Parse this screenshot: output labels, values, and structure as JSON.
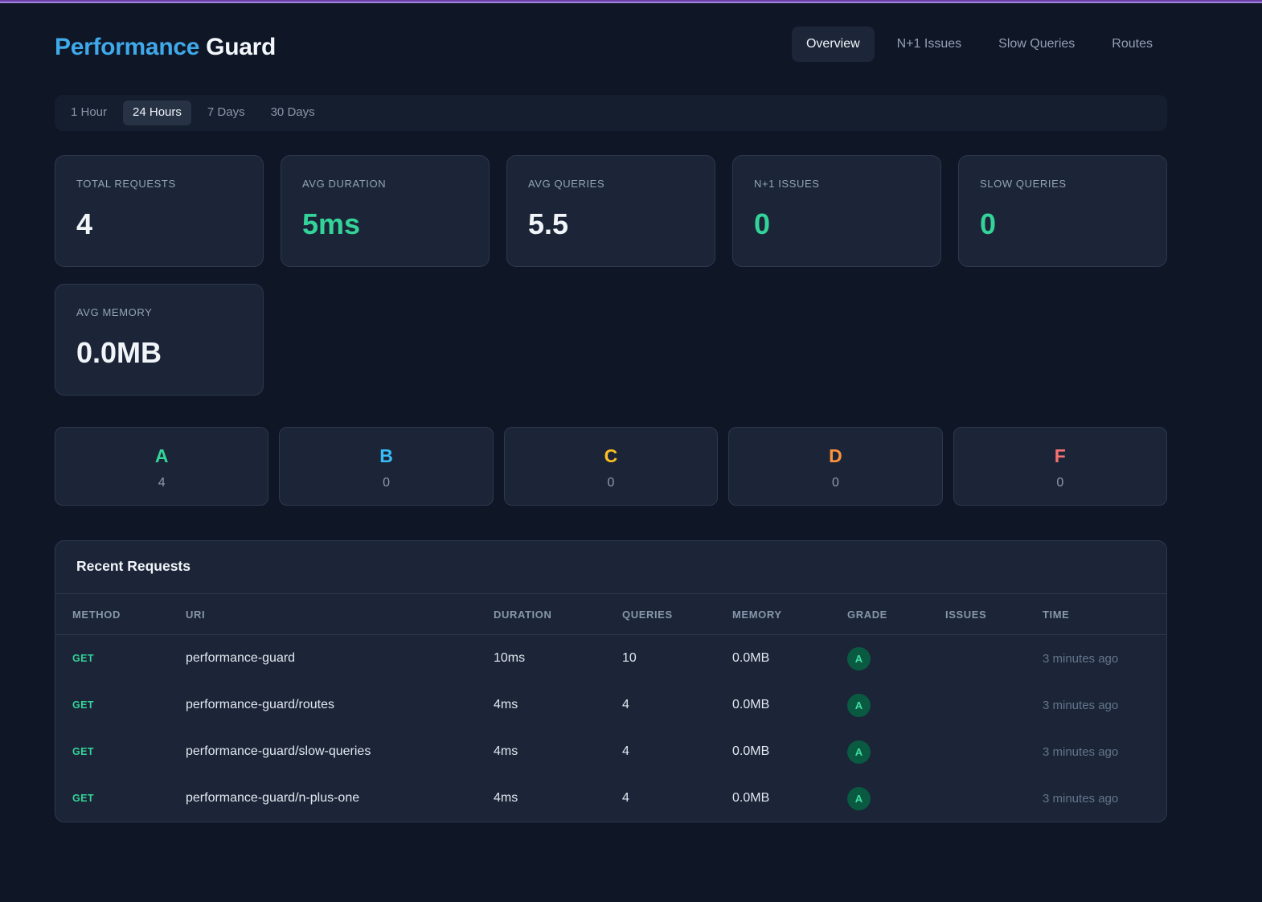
{
  "header": {
    "title_primary": "Performance",
    "title_secondary": "Guard"
  },
  "nav": {
    "items": [
      {
        "label": "Overview",
        "active": true
      },
      {
        "label": "N+1 Issues",
        "active": false
      },
      {
        "label": "Slow Queries",
        "active": false
      },
      {
        "label": "Routes",
        "active": false
      }
    ]
  },
  "time_ranges": {
    "items": [
      {
        "label": "1 Hour",
        "active": false
      },
      {
        "label": "24 Hours",
        "active": true
      },
      {
        "label": "7 Days",
        "active": false
      },
      {
        "label": "30 Days",
        "active": false
      }
    ]
  },
  "stats": [
    {
      "label": "TOTAL REQUESTS",
      "value": "4",
      "color": "#f1f5f9"
    },
    {
      "label": "AVG DURATION",
      "value": "5ms",
      "color": "#34d399"
    },
    {
      "label": "AVG QUERIES",
      "value": "5.5",
      "color": "#f1f5f9"
    },
    {
      "label": "N+1 ISSUES",
      "value": "0",
      "color": "#34d399"
    },
    {
      "label": "SLOW QUERIES",
      "value": "0",
      "color": "#34d399"
    },
    {
      "label": "AVG MEMORY",
      "value": "0.0MB",
      "color": "#f1f5f9"
    }
  ],
  "grades": [
    {
      "letter": "A",
      "count": "4",
      "color": "#34d399"
    },
    {
      "letter": "B",
      "count": "0",
      "color": "#38bdf8"
    },
    {
      "letter": "C",
      "count": "0",
      "color": "#fbbf24"
    },
    {
      "letter": "D",
      "count": "0",
      "color": "#fb923c"
    },
    {
      "letter": "F",
      "count": "0",
      "color": "#f87171"
    }
  ],
  "table": {
    "title": "Recent Requests",
    "columns": [
      "METHOD",
      "URI",
      "DURATION",
      "QUERIES",
      "MEMORY",
      "GRADE",
      "ISSUES",
      "TIME"
    ],
    "rows": [
      {
        "method": "GET",
        "uri": "performance-guard",
        "duration": "10ms",
        "queries": "10",
        "memory": "0.0MB",
        "grade": "A",
        "issues": "",
        "time": "3 minutes ago"
      },
      {
        "method": "GET",
        "uri": "performance-guard/routes",
        "duration": "4ms",
        "queries": "4",
        "memory": "0.0MB",
        "grade": "A",
        "issues": "",
        "time": "3 minutes ago"
      },
      {
        "method": "GET",
        "uri": "performance-guard/slow-queries",
        "duration": "4ms",
        "queries": "4",
        "memory": "0.0MB",
        "grade": "A",
        "issues": "",
        "time": "3 minutes ago"
      },
      {
        "method": "GET",
        "uri": "performance-guard/n-plus-one",
        "duration": "4ms",
        "queries": "4",
        "memory": "0.0MB",
        "grade": "A",
        "issues": "",
        "time": "3 minutes ago"
      }
    ],
    "method_color": "#34d399",
    "grade_badge_bg": "#0a5a41",
    "grade_badge_color": "#3fdca2"
  }
}
